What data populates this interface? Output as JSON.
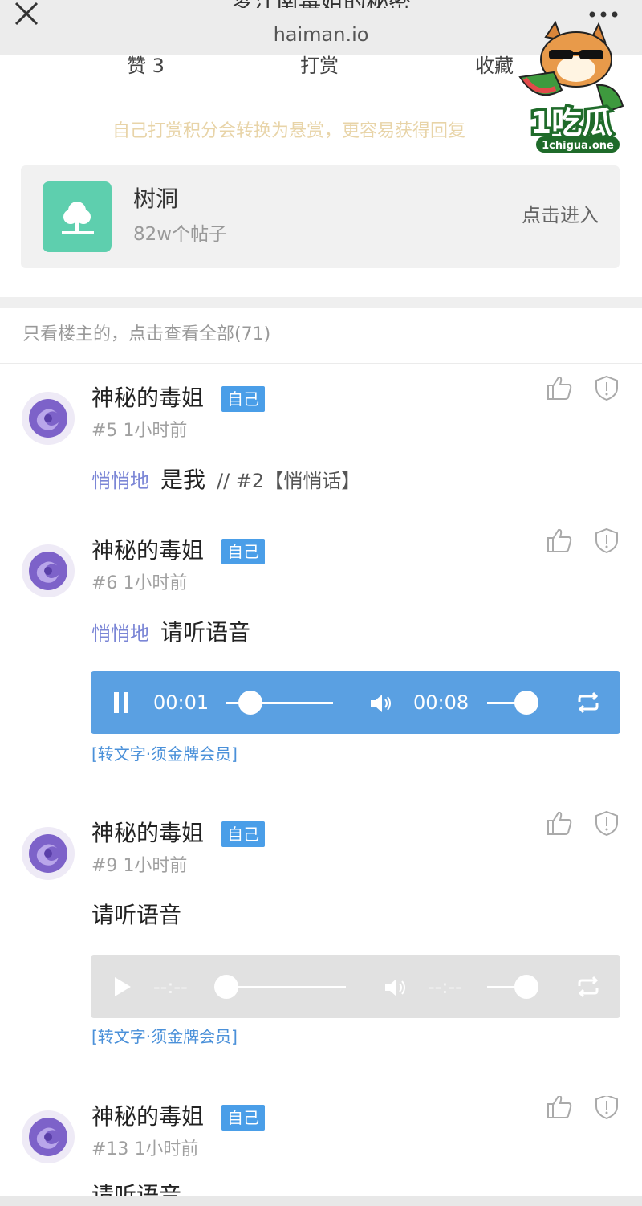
{
  "header": {
    "title": "梦江南毒姐的秘密",
    "domain": "haiman.io",
    "close_icon": "close-icon",
    "more_icon": "more-dots-icon"
  },
  "actions": {
    "like_label": "赞 3",
    "tip_label": "打赏",
    "favorite_label": "收藏"
  },
  "tip_hint": "自己打赏积分会转换为悬赏，更容易获得回复",
  "forum": {
    "name": "树洞",
    "count": "82w个帖子",
    "enter_label": "点击进入",
    "icon": "tree-icon",
    "icon_color": "#5ecfae"
  },
  "filter_label": "只看楼主的，点击查看全部(71)",
  "posts": [
    {
      "author": "神秘的毒姐",
      "badge": "自己",
      "floor": "#5",
      "time": "1小时前",
      "whisper": "悄悄地",
      "text": "是我",
      "quote": "// #2【悄悄话】"
    },
    {
      "author": "神秘的毒姐",
      "badge": "自己",
      "floor": "#6",
      "time": "1小时前",
      "whisper": "悄悄地",
      "text": "请听语音",
      "audio": {
        "state": "playing",
        "current": "00:01",
        "duration": "00:08",
        "progress": 0.2,
        "volume": 0.8
      },
      "convert_label": "[转文字·须金牌会员]"
    },
    {
      "author": "神秘的毒姐",
      "badge": "自己",
      "floor": "#9",
      "time": "1小时前",
      "text": "请听语音",
      "audio": {
        "state": "idle",
        "current": "--:--",
        "duration": "--:--",
        "progress": 0.0,
        "volume": 0.8
      },
      "convert_label": "[转文字·须金牌会员]"
    },
    {
      "author": "神秘的毒姐",
      "badge": "自己",
      "floor": "#13",
      "time": "1小时前",
      "text": "请听语音"
    }
  ],
  "watermark": {
    "logo_text": "1吃瓜",
    "logo_domain": "1chigua.one"
  },
  "colors": {
    "badge": "#4a9ee8",
    "audio_active": "#5aa0e2",
    "audio_idle": "#e1e1e1",
    "whisper": "#7b86d6",
    "hint": "#e8d4a8"
  }
}
